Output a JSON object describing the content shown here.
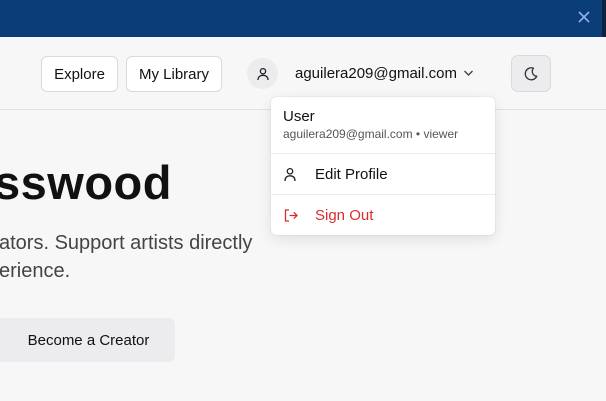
{
  "topbar": {
    "close_icon": "close-icon",
    "color": "#0b3d78"
  },
  "header": {
    "explore_label": "Explore",
    "library_label": "My Library",
    "user_icon": "user-icon",
    "account_label": "aguilera209@gmail.com",
    "chevron_icon": "chevron-down-icon",
    "theme_icon": "moon-icon"
  },
  "hero": {
    "title": "sswood",
    "line1": "ators. Support artists directly",
    "line2": "erience.",
    "creator_button": "Become a Creator"
  },
  "dropdown": {
    "user_heading": "User",
    "user_detail": "aguilera209@gmail.com • viewer",
    "edit_profile": "Edit Profile",
    "sign_out": "Sign Out",
    "danger_color": "#d92d2d"
  }
}
